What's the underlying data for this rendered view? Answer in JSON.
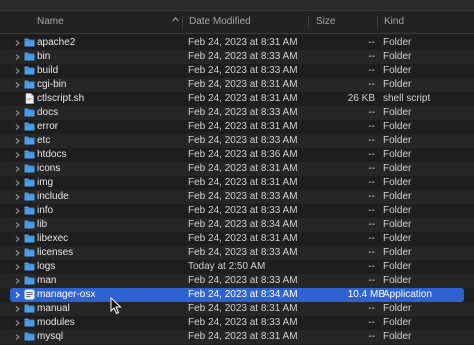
{
  "columns": {
    "name": "Name",
    "date": "Date Modified",
    "size": "Size",
    "kind": "Kind"
  },
  "icons": {
    "folder": "folder-icon",
    "script": "document-icon",
    "app": "application-icon",
    "disclosure": "chevron-right-icon",
    "sort": "chevron-up-icon"
  },
  "colors": {
    "folder": "#4a9fe8",
    "selection": "#2f62d1"
  },
  "rows": [
    {
      "name": "apache2",
      "date": "Feb 24, 2023 at 8:31 AM",
      "size": "--",
      "kind": "Folder",
      "type": "folder"
    },
    {
      "name": "bin",
      "date": "Feb 24, 2023 at 8:33 AM",
      "size": "--",
      "kind": "Folder",
      "type": "folder"
    },
    {
      "name": "build",
      "date": "Feb 24, 2023 at 8:33 AM",
      "size": "--",
      "kind": "Folder",
      "type": "folder"
    },
    {
      "name": "cgi-bin",
      "date": "Feb 24, 2023 at 8:31 AM",
      "size": "--",
      "kind": "Folder",
      "type": "folder"
    },
    {
      "name": "ctlscript.sh",
      "date": "Feb 24, 2023 at 8:31 AM",
      "size": "26 KB",
      "kind": "shell script",
      "type": "script"
    },
    {
      "name": "docs",
      "date": "Feb 24, 2023 at 8:33 AM",
      "size": "--",
      "kind": "Folder",
      "type": "folder"
    },
    {
      "name": "error",
      "date": "Feb 24, 2023 at 8:31 AM",
      "size": "--",
      "kind": "Folder",
      "type": "folder"
    },
    {
      "name": "etc",
      "date": "Feb 24, 2023 at 8:33 AM",
      "size": "--",
      "kind": "Folder",
      "type": "folder"
    },
    {
      "name": "htdocs",
      "date": "Feb 24, 2023 at 8:36 AM",
      "size": "--",
      "kind": "Folder",
      "type": "folder"
    },
    {
      "name": "icons",
      "date": "Feb 24, 2023 at 8:31 AM",
      "size": "--",
      "kind": "Folder",
      "type": "folder"
    },
    {
      "name": "img",
      "date": "Feb 24, 2023 at 8:31 AM",
      "size": "--",
      "kind": "Folder",
      "type": "folder"
    },
    {
      "name": "include",
      "date": "Feb 24, 2023 at 8:33 AM",
      "size": "--",
      "kind": "Folder",
      "type": "folder"
    },
    {
      "name": "info",
      "date": "Feb 24, 2023 at 8:33 AM",
      "size": "--",
      "kind": "Folder",
      "type": "folder"
    },
    {
      "name": "lib",
      "date": "Feb 24, 2023 at 8:34 AM",
      "size": "--",
      "kind": "Folder",
      "type": "folder"
    },
    {
      "name": "libexec",
      "date": "Feb 24, 2023 at 8:31 AM",
      "size": "--",
      "kind": "Folder",
      "type": "folder"
    },
    {
      "name": "licenses",
      "date": "Feb 24, 2023 at 8:33 AM",
      "size": "--",
      "kind": "Folder",
      "type": "folder"
    },
    {
      "name": "logs",
      "date": "Today at 2:50 AM",
      "size": "--",
      "kind": "Folder",
      "type": "folder"
    },
    {
      "name": "man",
      "date": "Feb 24, 2023 at 8:33 AM",
      "size": "--",
      "kind": "Folder",
      "type": "folder"
    },
    {
      "name": "manager-osx",
      "date": "Feb 24, 2023 at 8:34 AM",
      "size": "10.4 MB",
      "kind": "Application",
      "type": "app",
      "selected": true
    },
    {
      "name": "manual",
      "date": "Feb 24, 2023 at 8:31 AM",
      "size": "--",
      "kind": "Folder",
      "type": "folder"
    },
    {
      "name": "modules",
      "date": "Feb 24, 2023 at 8:33 AM",
      "size": "--",
      "kind": "Folder",
      "type": "folder"
    },
    {
      "name": "mysql",
      "date": "Feb 24, 2023 at 8:31 AM",
      "size": "--",
      "kind": "Folder",
      "type": "folder"
    }
  ]
}
